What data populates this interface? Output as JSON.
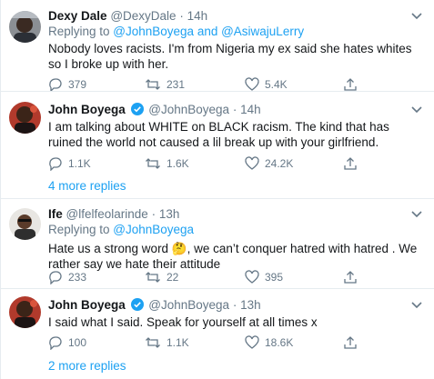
{
  "tweets": [
    {
      "name": "Dexy Dale",
      "handle": "@DexyDale",
      "dot": "·",
      "time": "14h",
      "replying_prefix": "Replying to ",
      "replying_users": "@JohnBoyega and @AsiwajuLerry",
      "text": "Nobody loves racists. I'm from Nigeria my ex said she hates whites so I broke up with her.",
      "replies": "379",
      "retweets": "231",
      "likes": "5.4K"
    },
    {
      "name": "John Boyega",
      "handle": "@JohnBoyega",
      "dot": "·",
      "time": "14h",
      "text": "I am talking about WHITE on BLACK racism. The kind that has ruined the world not caused a lil break up with your girlfriend.",
      "replies": "1.1K",
      "retweets": "1.6K",
      "likes": "24.2K"
    },
    {
      "name": "Ife",
      "handle": "@lfelfeolarinde",
      "dot": "·",
      "time": "13h",
      "replying_prefix": "Replying to ",
      "replying_users": "@JohnBoyega",
      "text_part1": "Hate us a strong word",
      "emoji": "🤔",
      "text_part2": ", we can’t  conquer hatred with hatred . We rather say we hate their attitude",
      "replies": "233",
      "retweets": "22",
      "likes": "395"
    },
    {
      "name": "John Boyega",
      "handle": "@JohnBoyega",
      "dot": "·",
      "time": "13h",
      "text": "I said what I said. Speak for yourself at all times x",
      "replies": "100",
      "retweets": "1.1K",
      "likes": "18.6K"
    }
  ],
  "more_replies_1": "4 more replies",
  "more_replies_2": "2 more replies",
  "colors": {
    "link": "#1da1f2",
    "muted": "#657786",
    "verified": "#1da1f2",
    "divider": "#e6ecf0"
  }
}
